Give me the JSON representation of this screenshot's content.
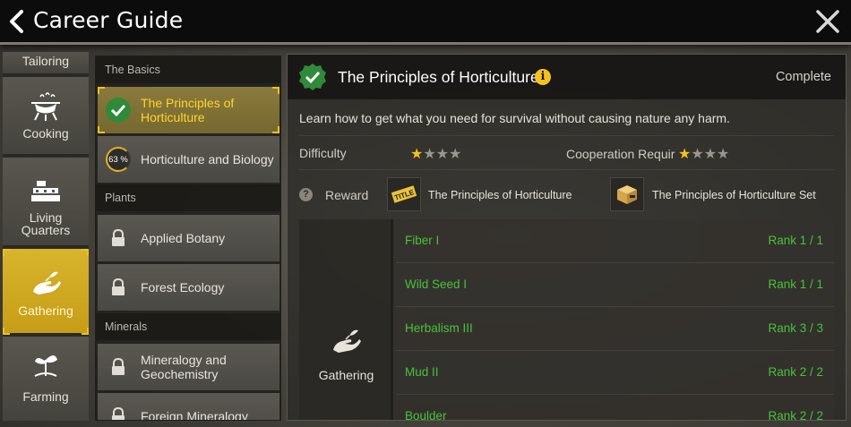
{
  "header": {
    "title": "Career Guide"
  },
  "categories": [
    {
      "label": "Tailoring",
      "icon": "tailoring-icon",
      "active": false
    },
    {
      "label": "Cooking",
      "icon": "cooking-pot-icon",
      "active": false
    },
    {
      "label": "Living\nQuarters",
      "icon": "living-quarters-icon",
      "active": false
    },
    {
      "label": "Gathering",
      "icon": "gathering-hand-icon",
      "active": true
    },
    {
      "label": "Farming",
      "icon": "farming-sprout-icon",
      "active": false
    }
  ],
  "courses": {
    "sections": [
      {
        "title": "The Basics"
      },
      {
        "title": "Plants"
      },
      {
        "title": "Minerals"
      }
    ],
    "items": [
      {
        "label": "The Principles of Horticulture",
        "state": "completed"
      },
      {
        "label": "Horticulture and Biology",
        "state": "in-progress",
        "progress": "63 %"
      },
      {
        "label": "Applied Botany",
        "state": "locked"
      },
      {
        "label": "Forest Ecology",
        "state": "locked"
      },
      {
        "label": "Mineralogy and Geochemistry",
        "state": "locked"
      },
      {
        "label": "Foreign Mineralogy",
        "state": "locked"
      }
    ]
  },
  "detail": {
    "title": "The Principles of Horticulture",
    "status": "Complete",
    "description": "Learn how to get what you need for survival without causing nature any harm.",
    "difficulty_label": "Difficulty",
    "difficulty_stars": 1,
    "cooperation_label": "Cooperation Requir",
    "cooperation_stars": 1,
    "max_stars": 4,
    "reward_label": "Reward",
    "rewards": [
      {
        "name": "The Principles of Horticulture",
        "icon": "title-tag-icon",
        "tag": "TITLE"
      },
      {
        "name": "The Principles of Horticulture Set",
        "icon": "supply-box-icon"
      }
    ],
    "skill_category": "Gathering",
    "skills": [
      {
        "name": "Fiber I",
        "rank": "Rank 1 / 1"
      },
      {
        "name": "Wild Seed I",
        "rank": "Rank 1 / 1"
      },
      {
        "name": "Herbalism III",
        "rank": "Rank 3 / 3"
      },
      {
        "name": "Mud II",
        "rank": "Rank 2 / 2"
      },
      {
        "name": "Boulder",
        "rank": "Rank 2 / 2"
      }
    ]
  },
  "colors": {
    "accent": "#f3c21e",
    "skill_text": "#46c23a",
    "selected_bg": "#c69d17"
  }
}
